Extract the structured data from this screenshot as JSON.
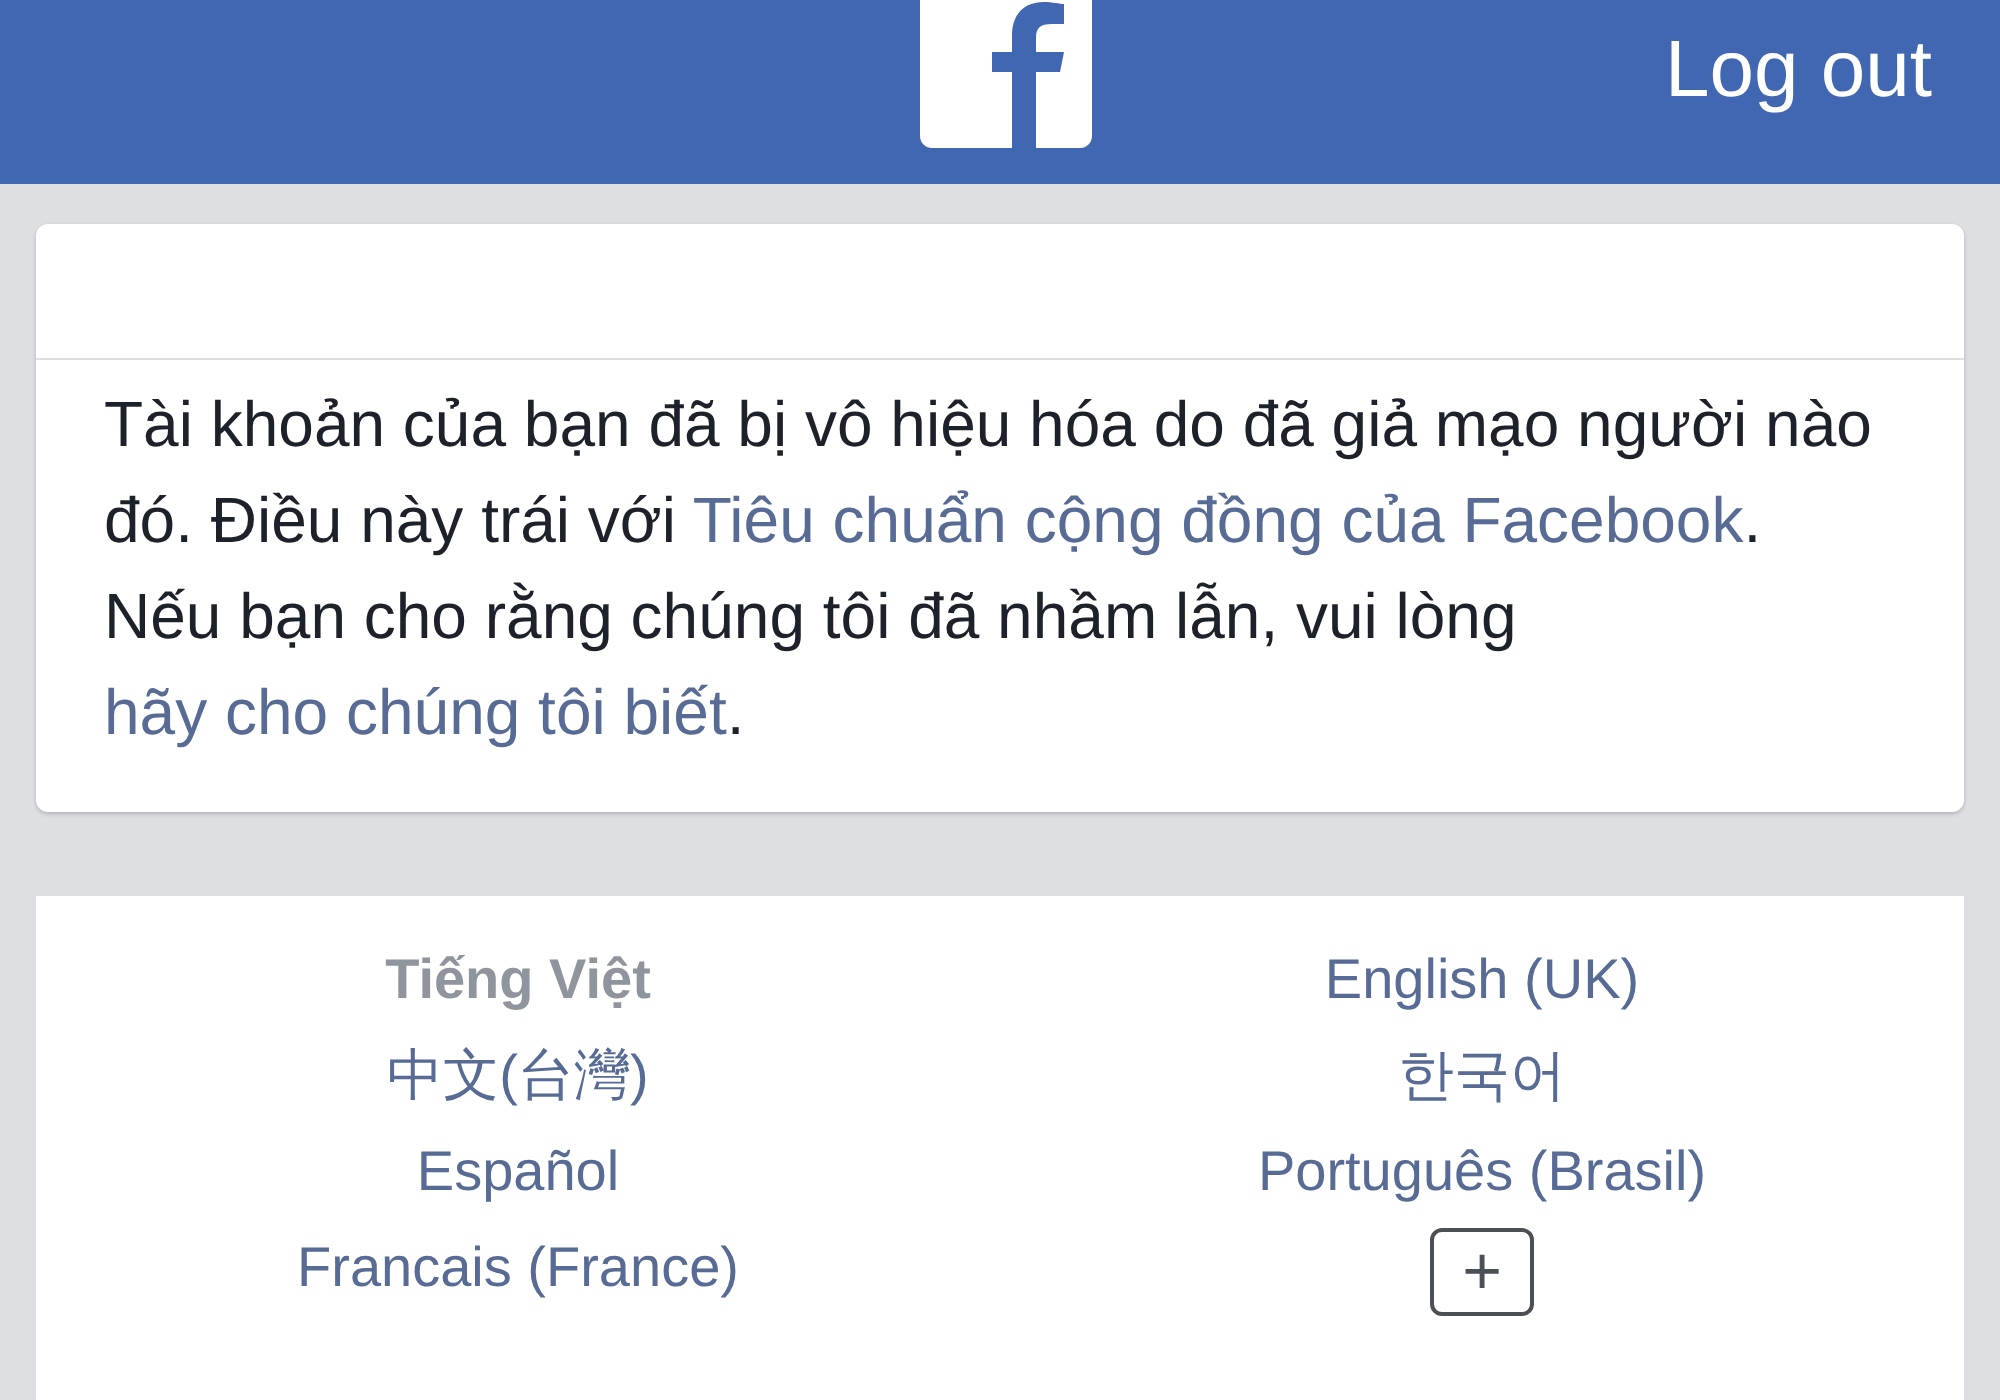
{
  "header": {
    "logout": "Log out"
  },
  "message": {
    "paragraphs": [
      [
        {
          "kind": "text",
          "text": "Tài khoản của bạn đã bị vô hiệu hóa do đã giả mạo người nào đó. Điều này trái với "
        },
        {
          "kind": "link",
          "text": "Tiêu chuẩn cộng đồng của Facebook"
        },
        {
          "kind": "text",
          "text": "."
        }
      ],
      [
        {
          "kind": "text",
          "text": "Nếu bạn cho rằng chúng tôi đã nhầm lẫn, vui lòng "
        },
        {
          "kind": "link",
          "text": "hãy cho chúng tôi biết"
        },
        {
          "kind": "text",
          "text": "."
        }
      ]
    ]
  },
  "languages": [
    {
      "label": "Tiếng Việt",
      "selected": true
    },
    {
      "label": "English (UK)",
      "selected": false
    },
    {
      "label": "中文(台灣)",
      "selected": false
    },
    {
      "label": "한국어",
      "selected": false
    },
    {
      "label": "Español",
      "selected": false
    },
    {
      "label": "Português (Brasil)",
      "selected": false
    },
    {
      "label": "Francais (France)",
      "selected": false
    }
  ],
  "more_languages": "+"
}
